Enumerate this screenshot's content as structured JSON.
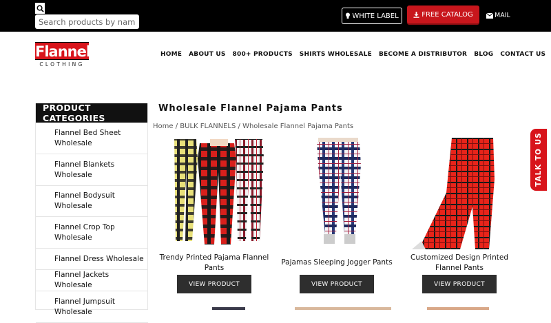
{
  "topbar": {
    "search_placeholder": "Search products by name or",
    "white_label": "WHITE LABEL",
    "free_catalog": "FREE CATALOG",
    "mail": "MAIL"
  },
  "logo": {
    "main": "Flannel",
    "sub": "CLOTHING"
  },
  "nav": [
    "HOME",
    "ABOUT US",
    "800+ PRODUCTS",
    "SHIRTS WHOLESALE",
    "BECOME A DISTRIBUTOR",
    "BLOG",
    "CONTACT US"
  ],
  "sidebar": {
    "title": "PRODUCT CATEGORIES",
    "items": [
      "Flannel Bed Sheet Wholesale",
      "Flannel Blankets Wholesale",
      "Flannel Bodysuit Wholesale",
      "Flannel Crop Top Wholesale",
      "Flannel Dress Wholesale",
      "Flannel Jackets Wholesale",
      "Flannel Jumpsuit Wholesale"
    ]
  },
  "page_title": "Wholesale Flannel Pajama Pants",
  "breadcrumb": "Home / BULK FLANNELS / Wholesale Flannel Pajama Pants",
  "products": [
    {
      "name": "Trendy Printed Pajama Flannel Pants",
      "button": "VIEW PRODUCT"
    },
    {
      "name": "Pajamas Sleeping Jogger Pants",
      "button": "VIEW PRODUCT"
    },
    {
      "name": "Customized Design Printed Flannel Pants",
      "button": "VIEW PRODUCT"
    }
  ],
  "talk_tab": "TALK TO US",
  "colors": {
    "brand_red": "#d8141b",
    "topbar": "#000000",
    "button_dark": "#2e2e2e"
  }
}
